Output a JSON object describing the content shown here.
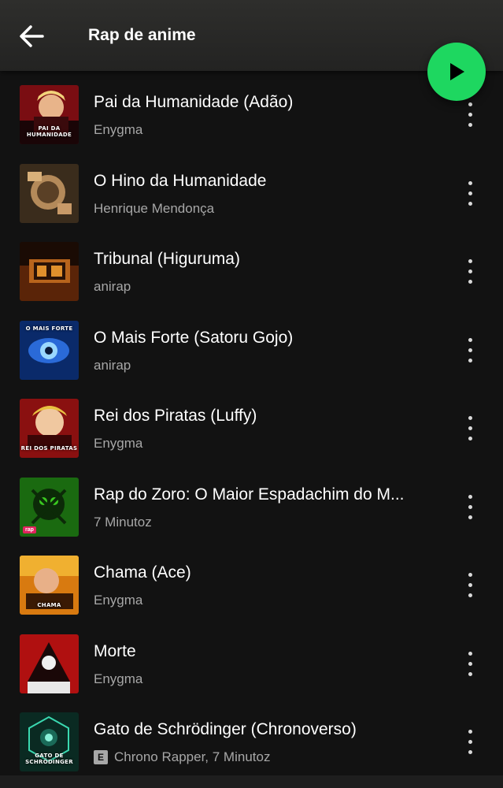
{
  "header": {
    "title": "Rap de anime"
  },
  "tracks": [
    {
      "title": "Pai da Humanidade (Adão)",
      "artist": "Enygma",
      "cover_text": "PAI DA HUMANIDADE",
      "explicit": false
    },
    {
      "title": "O Hino da Humanidade",
      "artist": "Henrique Mendonça",
      "cover_text": "",
      "explicit": false
    },
    {
      "title": "Tribunal (Higuruma)",
      "artist": "anirap",
      "cover_text": "",
      "explicit": false
    },
    {
      "title": "O Mais Forte (Satoru Gojo)",
      "artist": "anirap",
      "cover_text": "O MAIS FORTE",
      "explicit": false
    },
    {
      "title": "Rei dos Piratas (Luffy)",
      "artist": "Enygma",
      "cover_text": "REI DOS PIRATAS",
      "explicit": false
    },
    {
      "title": "Rap do Zoro: O Maior Espadachim do M...",
      "artist": "7 Minutoz",
      "cover_text": "",
      "tag": "rap",
      "explicit": false
    },
    {
      "title": "Chama (Ace)",
      "artist": "Enygma",
      "cover_text": "CHAMA",
      "explicit": false
    },
    {
      "title": "Morte",
      "artist": "Enygma",
      "cover_text": "",
      "explicit": false
    },
    {
      "title": "Gato de Schrödinger (Chronoverso)",
      "artist": "Chrono Rapper, 7 Minutoz",
      "cover_text": "GATO DE SCHRÖDINGER",
      "explicit": true,
      "explicit_label": "E"
    }
  ],
  "colors": {
    "accent": "#1ed760",
    "background": "#121212",
    "secondary_text": "#a7a7a7"
  }
}
